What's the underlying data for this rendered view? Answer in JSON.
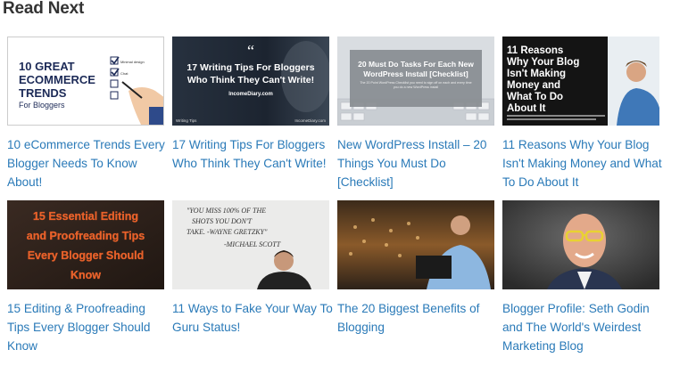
{
  "section": {
    "heading": "Read Next"
  },
  "articles": [
    {
      "title": "10 eCommerce Trends Every Blogger Needs To Know About!",
      "thumb": {
        "line1": "10 GREAT",
        "line2": "ECOMMERCE",
        "line3": "TRENDS",
        "line4": "For Bloggers",
        "check1": "Minimal design",
        "check2": "Chat"
      }
    },
    {
      "title": "17 Writing Tips For Bloggers Who Think They Can't Write!",
      "thumb": {
        "quote": "“",
        "line1": "17 Writing Tips For Bloggers",
        "line2": "Who Think They Can't Write!",
        "site": "IncomeDiary.com",
        "footer_left": "Writing Tips",
        "footer_right": "IncomeDiary.com"
      }
    },
    {
      "title": "New WordPress Install – 20 Things You Must Do [Checklist]",
      "thumb": {
        "line1": "20 Must Do Tasks For Each New",
        "line2": "WordPress Install [Checklist]",
        "sub": "The 20 Point WordPress Checklist you need to sign off on each and every time you do a new WordPress install"
      }
    },
    {
      "title": "11 Reasons Why Your Blog Isn't Making Money and What To Do About It",
      "thumb": {
        "line1": "11 Reasons",
        "line2": "Why Your Blog",
        "line3": "Isn't Making",
        "line4": "Money and",
        "line5": "What To Do",
        "line6": "About It"
      }
    },
    {
      "title": "15 Editing & Proofreading Tips Every Blogger Should Know",
      "thumb": {
        "line1": "15 Essential Editing",
        "line2": "and Proofreading Tips",
        "line3": "Every Blogger Should",
        "line4": "Know"
      }
    },
    {
      "title": "11 Ways to Fake Your Way To Guru Status!",
      "thumb": {
        "line1": "\"YOU MISS 100% OF THE",
        "line2": "SHOTS YOU DON'T",
        "line3": "TAKE. -WAYNE GRETZKY\"",
        "line4": "-MICHAEL SCOTT"
      }
    },
    {
      "title": "The 20 Biggest Benefits of Blogging",
      "thumb": {}
    },
    {
      "title": "Blogger Profile: Seth Godin and The World's Weirdest Marketing Blog",
      "thumb": {}
    }
  ],
  "colors": {
    "link": "#2a7ab8",
    "heading": "#333333",
    "orange": "#e8612a",
    "navy": "#1c2a57"
  }
}
